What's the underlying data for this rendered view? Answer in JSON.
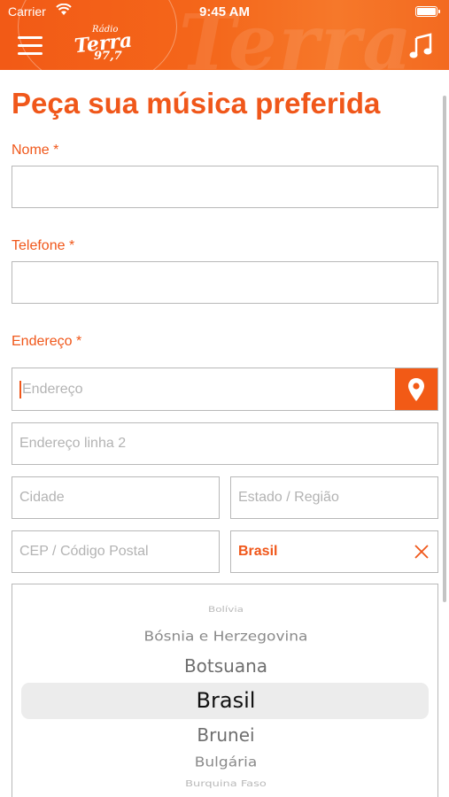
{
  "status_bar": {
    "carrier": "Carrier",
    "time": "9:45 AM"
  },
  "header": {
    "logo_radio": "Rádio",
    "logo_terra": "Terra",
    "logo_freq": "97,7",
    "menu_icon": "hamburger-menu-icon",
    "music_icon": "music-note-icon"
  },
  "page": {
    "title": "Peça sua música preferida"
  },
  "form": {
    "nome_label": "Nome *",
    "telefone_label": "Telefone *",
    "endereco_label": "Endereço *",
    "endereco_placeholder": "Endereço",
    "endereco2_placeholder": "Endereço linha 2",
    "cidade_placeholder": "Cidade",
    "estado_placeholder": "Estado / Região",
    "cep_placeholder": "CEP / Código Postal",
    "pais_value": "Brasil"
  },
  "picker": {
    "options": [
      "Bolívia",
      "Bósnia e Herzegovina",
      "Botsuana",
      "Brasil",
      "Brunei",
      "Bulgária",
      "Burquina Faso"
    ],
    "selected": "Brasil"
  },
  "colors": {
    "accent": "#f0571a",
    "border": "#b8b8b8",
    "placeholder": "#b3b3b3"
  }
}
